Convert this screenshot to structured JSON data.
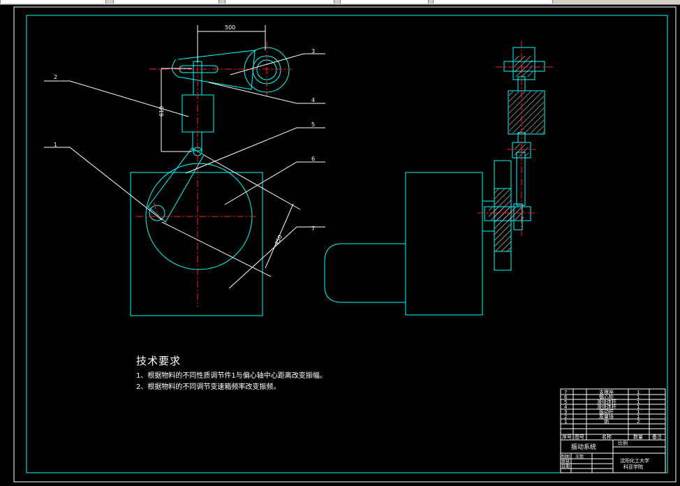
{
  "dimensions": {
    "d500": "500",
    "d610": "610",
    "d450": "450"
  },
  "balloons": [
    "1",
    "2",
    "3",
    "4",
    "5",
    "6",
    "7"
  ],
  "technical_requirements": {
    "title": "技术要求",
    "items": [
      "1、根据物料的不同性质调节件1与偏心轴中心距离改变振幅。",
      "2、根据物料的不同调节变速箱频率改变振频。"
    ]
  },
  "parts_list": {
    "rows": [
      {
        "no": "7",
        "name": "支撑座",
        "qty": "1"
      },
      {
        "no": "6",
        "name": "偏心轮",
        "qty": "1"
      },
      {
        "no": "5",
        "name": "滑块连杆",
        "qty": "1"
      },
      {
        "no": "4",
        "name": "滑块连杆",
        "qty": "1"
      },
      {
        "no": "3",
        "name": "振动杆",
        "qty": "1"
      },
      {
        "no": "2",
        "name": "质量块",
        "qty": "1"
      },
      {
        "no": "1",
        "name": "销",
        "qty": "2"
      }
    ],
    "header": {
      "no": "序号",
      "code": "图号",
      "name": "名称",
      "qty": "数量",
      "note": "备注"
    }
  },
  "title_block": {
    "drawing_name": "振动系统",
    "scale_label": "比例",
    "designer_label": "制图",
    "designer_name": "王熙",
    "reviewer_label": "审核",
    "date_label": "日期",
    "school": "沈阳化工大学",
    "college": "科亚学院"
  },
  "colors": {
    "outline": "#00ffff",
    "centerline": "#ff2020",
    "dimension": "#ffffff",
    "background": "#000000"
  }
}
